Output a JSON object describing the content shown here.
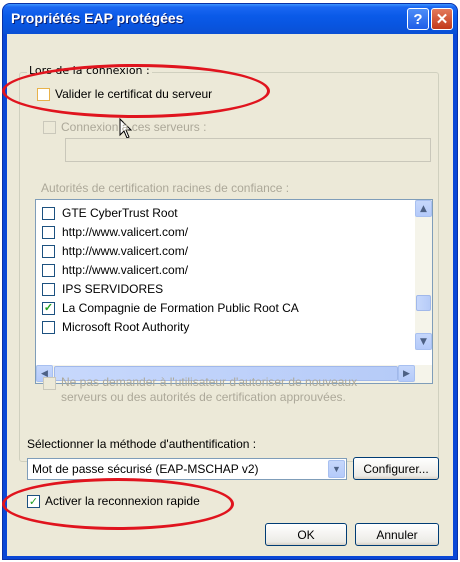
{
  "window": {
    "title": "Propriétés EAP protégées",
    "help_icon": "question-mark-icon",
    "close_icon": "close-x-icon"
  },
  "connection": {
    "group_label": "Lors de la connexion :",
    "validate_cert_label": "Valider le certificat du serveur",
    "validate_cert_checked": false,
    "connect_servers_label": "Connexion à ces serveurs :",
    "servers_value": ""
  },
  "root_authorities": {
    "label": "Autorités de certification racines de confiance :",
    "items": [
      {
        "label": "GTE CyberTrust Root",
        "checked": false
      },
      {
        "label": "http://www.valicert.com/",
        "checked": false
      },
      {
        "label": "http://www.valicert.com/",
        "checked": false
      },
      {
        "label": "http://www.valicert.com/",
        "checked": false
      },
      {
        "label": "IPS SERVIDORES",
        "checked": false
      },
      {
        "label": "La Compagnie de Formation Public Root CA",
        "checked": true
      },
      {
        "label": "Microsoft Root Authority",
        "checked": false
      }
    ]
  },
  "no_prompt": {
    "line1": "Ne pas demander à l'utilisateur d'autoriser de nouveaux",
    "line2": "serveurs ou des autorités de certification approuvées."
  },
  "auth": {
    "label": "Sélectionner la méthode d'authentification :",
    "selected": "Mot de passe sécurisé (EAP-MSCHAP v2)",
    "configure_label": "Configurer..."
  },
  "fast_reconnect": {
    "label": "Activer la reconnexion rapide",
    "checked": true
  },
  "buttons": {
    "ok": "OK",
    "cancel": "Annuler"
  },
  "colors": {
    "titlebar": "#0a5ae8",
    "highlight_ellipse": "#e0141e",
    "dialog_bg": "#ece9d8"
  }
}
